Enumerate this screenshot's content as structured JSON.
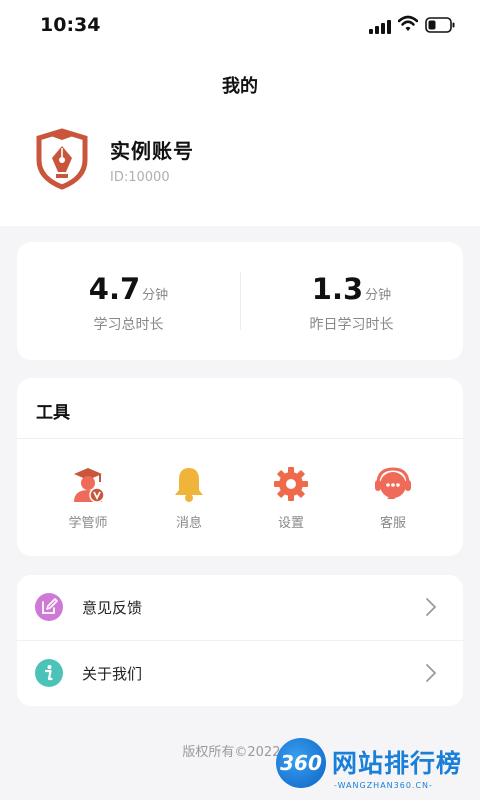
{
  "status_bar": {
    "time": "10:34"
  },
  "header": {
    "title": "我的"
  },
  "account": {
    "name": "实例账号",
    "id_prefix": "ID:",
    "id_value": "10000"
  },
  "stats": [
    {
      "value": "4.7",
      "unit": "分钟",
      "label": "学习总时长"
    },
    {
      "value": "1.3",
      "unit": "分钟",
      "label": "昨日学习时长"
    }
  ],
  "tools": {
    "title": "工具",
    "items": [
      {
        "label": "学管师",
        "icon": "tutor-icon"
      },
      {
        "label": "消息",
        "icon": "bell-icon"
      },
      {
        "label": "设置",
        "icon": "gear-icon"
      },
      {
        "label": "客服",
        "icon": "headset-icon"
      }
    ]
  },
  "menu": [
    {
      "label": "意见反馈",
      "icon": "edit-icon"
    },
    {
      "label": "关于我们",
      "icon": "info-icon"
    }
  ],
  "footer": {
    "copyright": "版权所有©2022 家"
  },
  "watermark": {
    "number": "360",
    "text": "网站排行榜",
    "url": "-WANGZHAN360.CN-"
  },
  "colors": {
    "brand_red": "#c9553a",
    "bell_yellow": "#f0b43a",
    "gear_orange": "#ee6a4a",
    "service_red": "#ef6a58",
    "feedback_purple": "#cf79d6",
    "info_teal": "#4cc3b8"
  }
}
